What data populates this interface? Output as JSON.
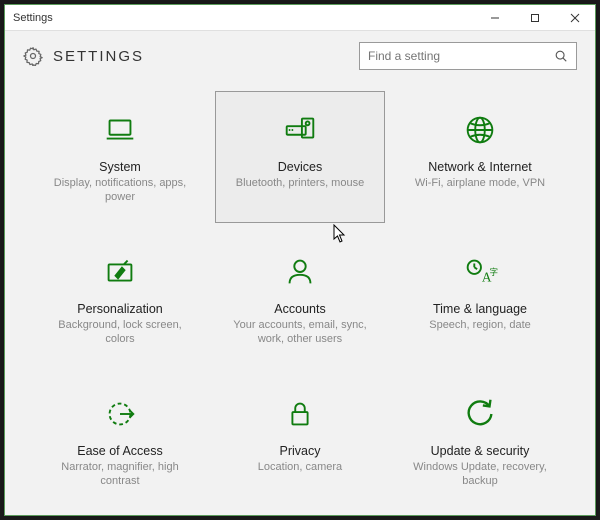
{
  "window": {
    "title": "Settings"
  },
  "header": {
    "title": "SETTINGS"
  },
  "search": {
    "placeholder": "Find a setting"
  },
  "tiles": [
    {
      "title": "System",
      "sub": "Display, notifications, apps, power"
    },
    {
      "title": "Devices",
      "sub": "Bluetooth, printers, mouse"
    },
    {
      "title": "Network & Internet",
      "sub": "Wi-Fi, airplane mode, VPN"
    },
    {
      "title": "Personalization",
      "sub": "Background, lock screen, colors"
    },
    {
      "title": "Accounts",
      "sub": "Your accounts, email, sync, work, other users"
    },
    {
      "title": "Time & language",
      "sub": "Speech, region, date"
    },
    {
      "title": "Ease of Access",
      "sub": "Narrator, magnifier, high contrast"
    },
    {
      "title": "Privacy",
      "sub": "Location, camera"
    },
    {
      "title": "Update & security",
      "sub": "Windows Update, recovery, backup"
    }
  ],
  "accent_color": "#107c10"
}
